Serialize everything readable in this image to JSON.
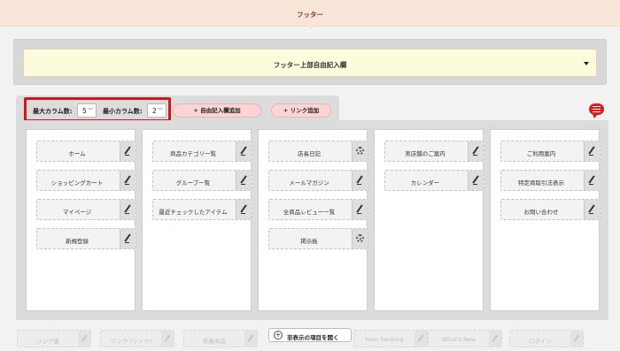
{
  "header": {
    "title": "フッター"
  },
  "free_input": {
    "label": "フッター上部自由記入欄"
  },
  "settings": {
    "max_columns_label": "最大カラム数:",
    "max_columns_value": "5",
    "min_columns_label": "最小カラム数:",
    "min_columns_value": "2"
  },
  "buttons": {
    "add_free_input": "+ 自由記入欄追加",
    "add_link": "+ リンク追加",
    "open_hidden": "非表示の項目を開く"
  },
  "columns": [
    {
      "items": [
        {
          "label": "ホーム",
          "icon": "pencil-icon"
        },
        {
          "label": "ショッピングカート",
          "icon": "pencil-icon"
        },
        {
          "label": "マイページ",
          "icon": "pencil-icon"
        },
        {
          "label": "新規登録",
          "icon": "pencil-icon"
        }
      ]
    },
    {
      "items": [
        {
          "label": "商品カテゴリ一覧",
          "icon": "pencil-icon"
        },
        {
          "label": "グループ一覧",
          "icon": "pencil-icon"
        },
        {
          "label": "最近チェックしたアイテム",
          "icon": "pencil-icon"
        }
      ]
    },
    {
      "items": [
        {
          "label": "店長日記",
          "icon": "gear-icon"
        },
        {
          "label": "メールマガジン",
          "icon": "pencil-icon"
        },
        {
          "label": "全商品レビュー一覧",
          "icon": "pencil-icon"
        },
        {
          "label": "掲示板",
          "icon": "gear-icon"
        }
      ]
    },
    {
      "items": [
        {
          "label": "実店舗のご案内",
          "icon": "pencil-icon"
        },
        {
          "label": "カレンダー",
          "icon": "pencil-icon"
        }
      ]
    },
    {
      "items": [
        {
          "label": "ご利用案内",
          "icon": "pencil-icon"
        },
        {
          "label": "特定商取引法表示",
          "icon": "pencil-icon"
        },
        {
          "label": "お問い合わせ",
          "icon": "pencil-icon"
        }
      ]
    }
  ],
  "hidden_items": [
    {
      "label": "リンク集"
    },
    {
      "label": "リンク (リンク)"
    },
    {
      "label": "新着商品"
    },
    {
      "label": "Item Ranking"
    },
    {
      "label": "What's New"
    },
    {
      "label": "ログイン"
    }
  ]
}
